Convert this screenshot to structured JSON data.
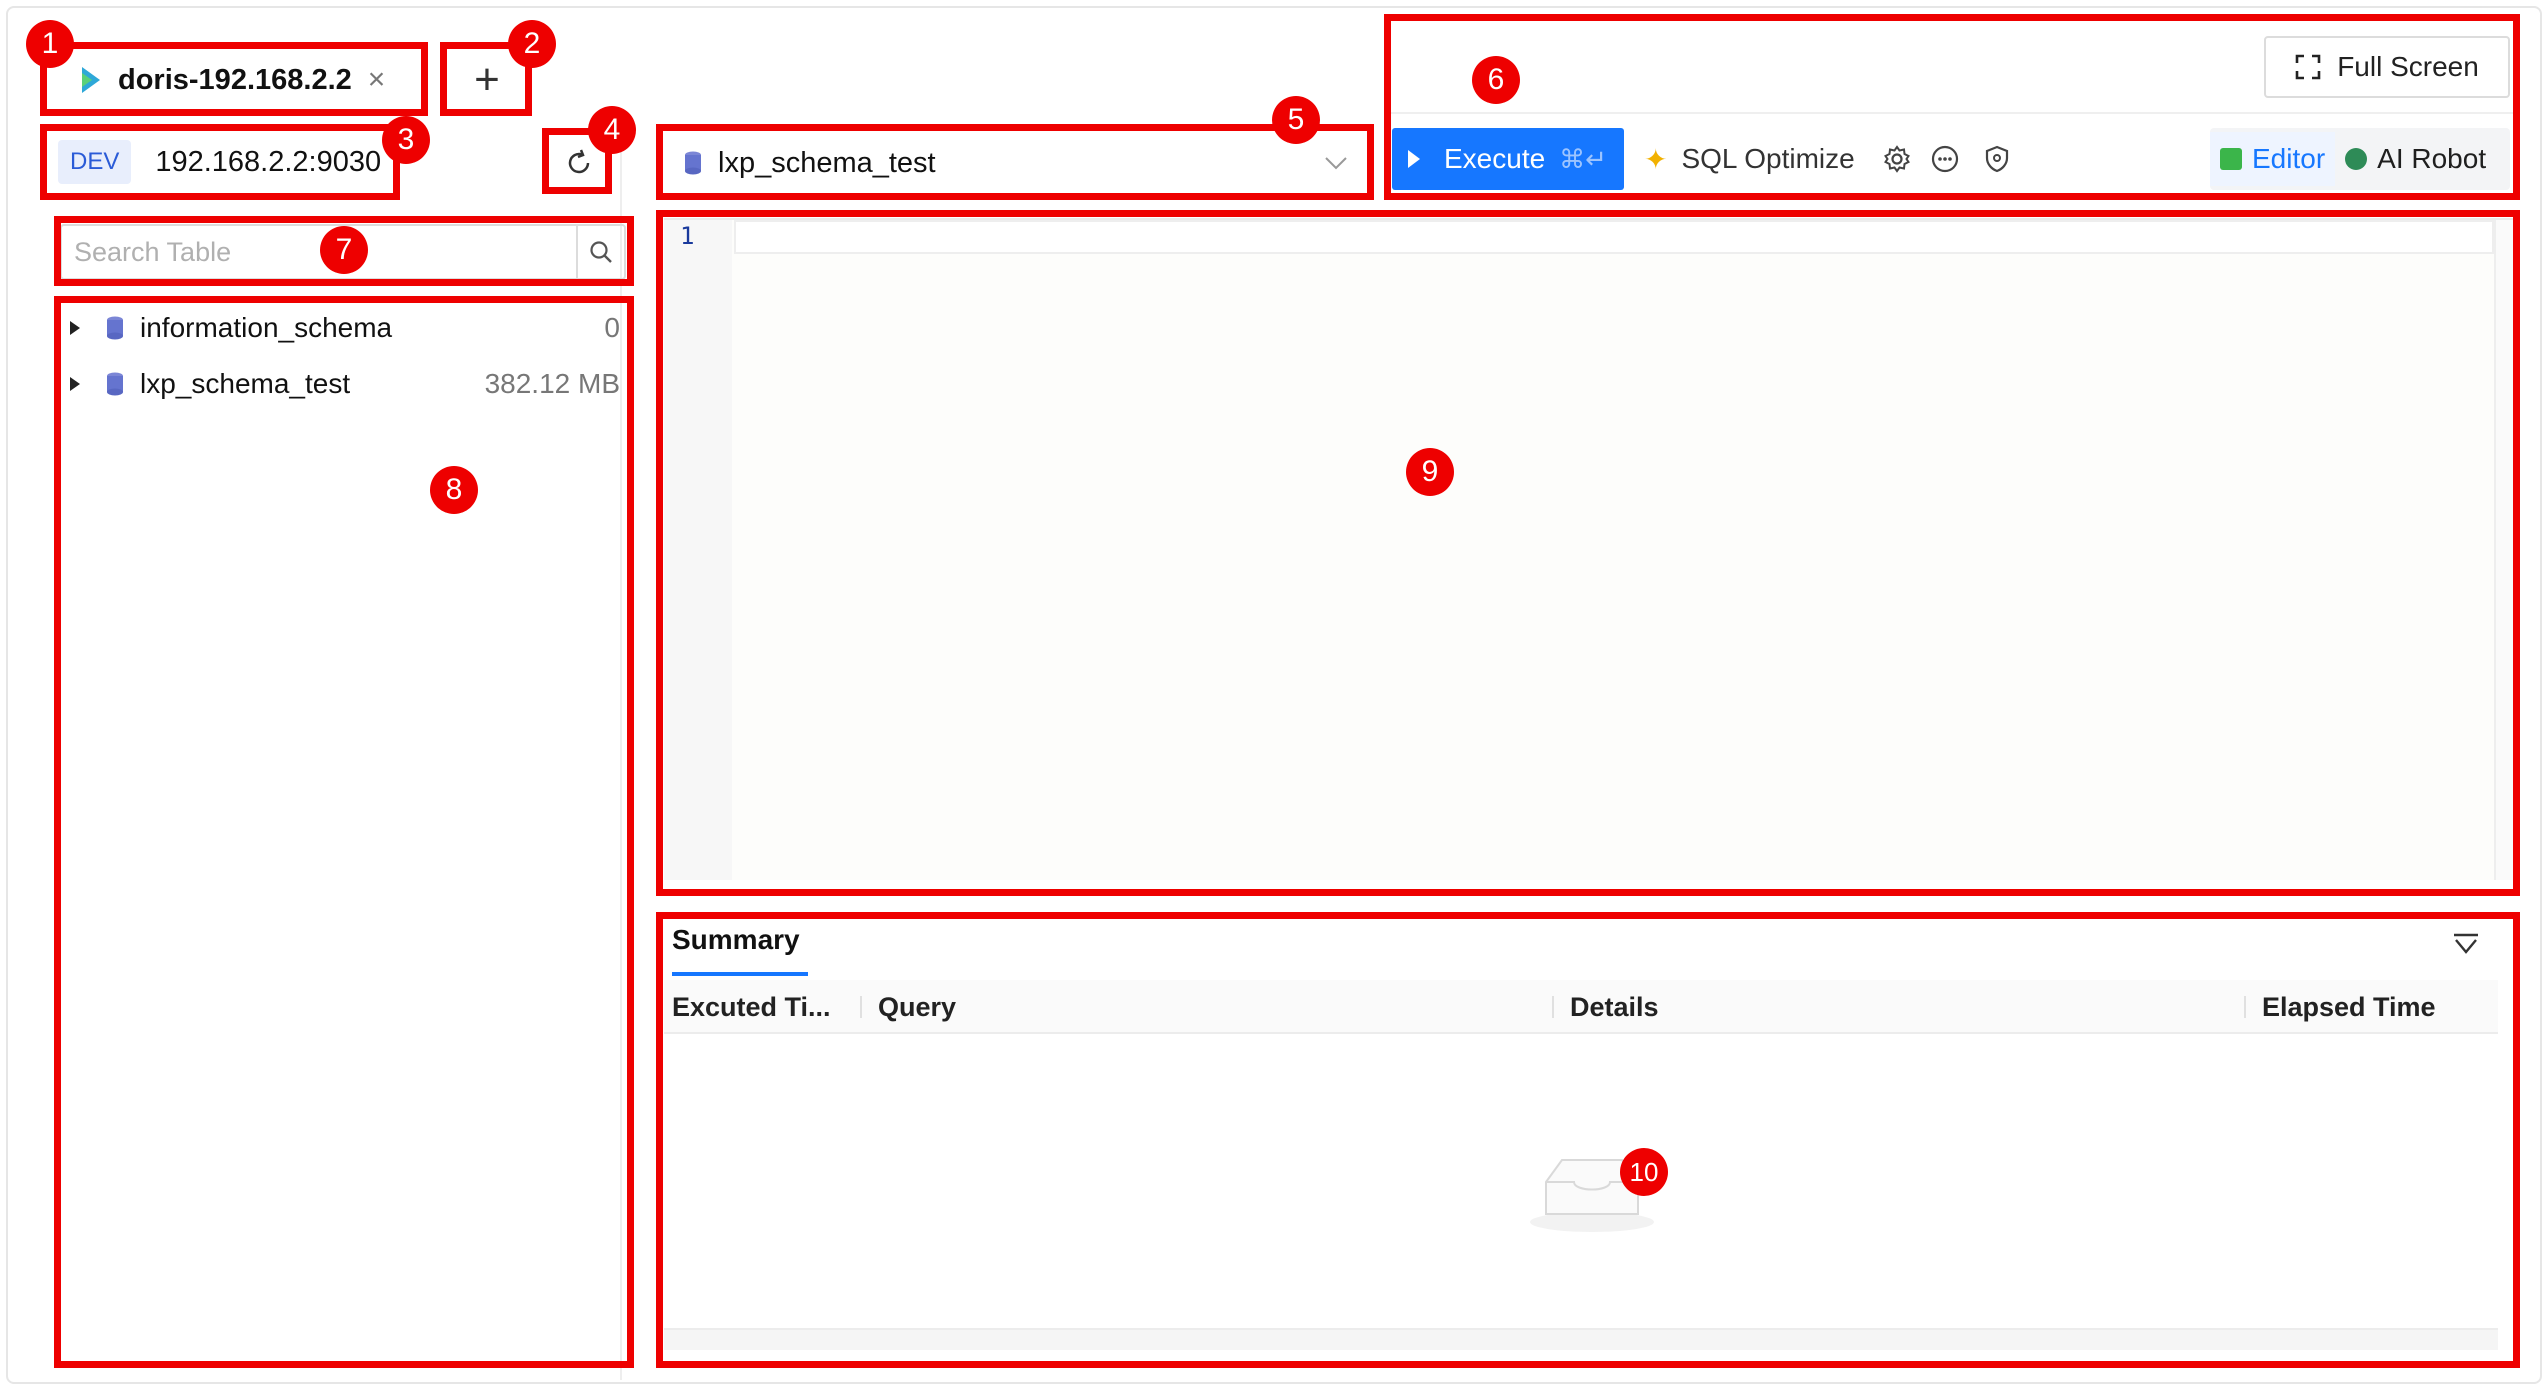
{
  "tabs": [
    {
      "title": "doris-192.168.2.2",
      "close_glyph": "×"
    }
  ],
  "add_tab_glyph": "+",
  "connection": {
    "env": "DEV",
    "host": "192.168.2.2:9030"
  },
  "search": {
    "placeholder": "Search Table",
    "value": ""
  },
  "databases": [
    {
      "name": "information_schema",
      "size": "0"
    },
    {
      "name": "lxp_schema_test",
      "size": "382.12 MB"
    }
  ],
  "db_select": {
    "value": "lxp_schema_test"
  },
  "toolbar": {
    "full_screen": "Full Screen",
    "execute": "Execute",
    "execute_shortcut": "⌘↵",
    "sql_optimize": "SQL Optimize",
    "modes": [
      "Editor",
      "AI Robot"
    ],
    "active_mode": "Editor"
  },
  "editor": {
    "line_numbers": [
      "1"
    ],
    "content": ""
  },
  "results": {
    "tab": "Summary",
    "columns": [
      "Excuted Ti...",
      "Query",
      "Details",
      "Elapsed Time"
    ],
    "rows": []
  },
  "annotations": [
    "1",
    "2",
    "3",
    "4",
    "5",
    "6",
    "7",
    "8",
    "9",
    "10"
  ],
  "colors": {
    "accent": "#1677ff",
    "annotation": "#ee0000",
    "env_badge_bg": "#e8eefc"
  }
}
